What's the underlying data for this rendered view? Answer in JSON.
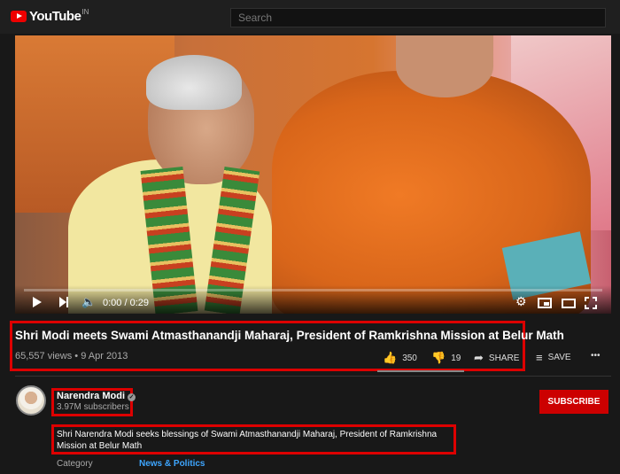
{
  "header": {
    "logo_text": "YouTube",
    "logo_country": "IN",
    "search_placeholder": "Search"
  },
  "player": {
    "time": "0:00 / 0:29",
    "progress": 0.0,
    "icons": [
      "play-icon",
      "next-icon",
      "volume-icon",
      "settings-icon",
      "miniplayer-icon",
      "theater-icon",
      "fullscreen-icon"
    ]
  },
  "video": {
    "title": "Shri Modi meets Swami Atmasthanandji Maharaj, President of Ramkrishna Mission at Belur Math",
    "views": "65,557 views",
    "date": "9 Apr 2013",
    "likes": "350",
    "dislikes": "19",
    "share_label": "SHARE",
    "save_label": "SAVE",
    "more_label": "•••"
  },
  "channel": {
    "name": "Narendra Modi",
    "subscribers": "3.97M subscribers",
    "subscribe_label": "SUBSCRIBE"
  },
  "description": {
    "text": "Shri Narendra Modi seeks blessings of Swami Atmasthanandji Maharaj, President of Ramkrishna Mission at Belur Math",
    "category_label": "Category",
    "category_value": "News & Politics"
  },
  "colors": {
    "highlight": "#dd0000",
    "subscribe": "#cc0000",
    "link": "#3ea6ff"
  }
}
